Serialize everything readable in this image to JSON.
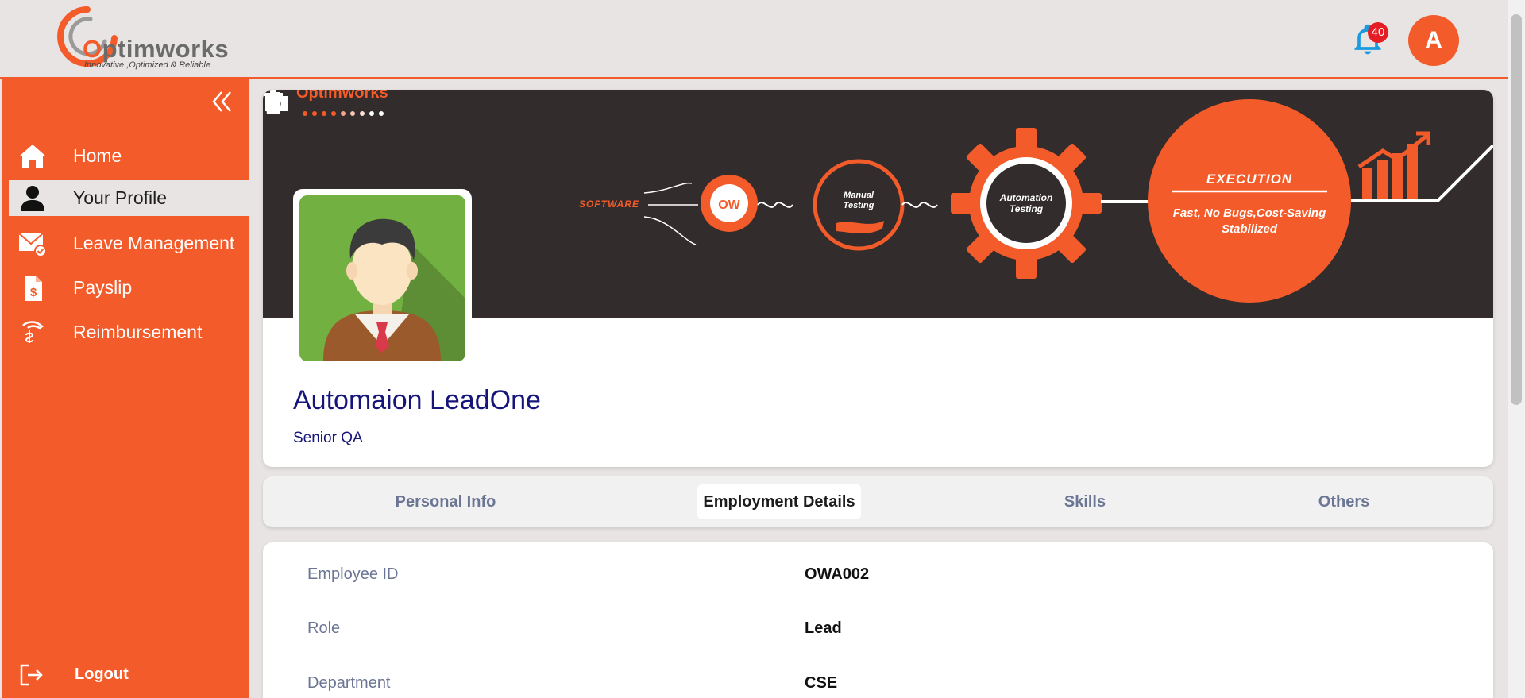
{
  "header": {
    "logo_letter": "O",
    "logo_rest": "ptimworks",
    "logo_tagline": "Innovative ,Optimized & Reliable",
    "notification_count": "40",
    "avatar_initial": "A"
  },
  "sidebar": {
    "items": [
      {
        "label": "Home",
        "icon": "home-icon"
      },
      {
        "label": "Your Profile",
        "icon": "user-icon",
        "active": true
      },
      {
        "label": "Leave Management",
        "icon": "mail-check-icon"
      },
      {
        "label": "Payslip",
        "icon": "payslip-icon"
      },
      {
        "label": "Reimbursement",
        "icon": "hand-money-icon"
      }
    ],
    "logout_label": "Logout"
  },
  "banner": {
    "logo_text": "Optimworks",
    "software": "SOFTWARE",
    "manual_1": "Manual",
    "manual_2": "Testing",
    "auto_1": "Automation",
    "auto_2": "Testing",
    "execution": "EXECUTION",
    "exec_1": "Fast, No Bugs,Cost-Saving",
    "exec_2": "Stabilized"
  },
  "profile": {
    "name": "Automaion LeadOne",
    "designation": "Senior QA"
  },
  "tabs": [
    {
      "label": "Personal Info",
      "active": false
    },
    {
      "label": "Employment Details",
      "active": true
    },
    {
      "label": "Skills",
      "active": false
    },
    {
      "label": "Others",
      "active": false
    }
  ],
  "details": [
    {
      "label": "Employee ID",
      "value": "OWA002"
    },
    {
      "label": "Role",
      "value": "Lead"
    },
    {
      "label": "Department",
      "value": "CSE"
    }
  ],
  "colors": {
    "brand": "#f35c2a",
    "banner_bg": "#322c2c",
    "name_text": "#16167a",
    "muted_text": "#6b7594",
    "bell": "#1a9be0"
  }
}
